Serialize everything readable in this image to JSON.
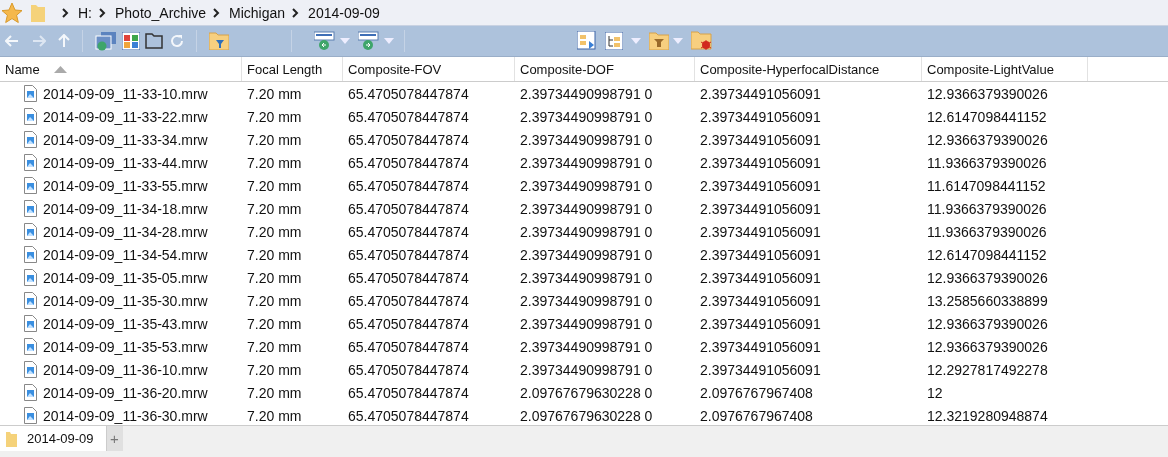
{
  "breadcrumb": {
    "favorite": true,
    "segments": [
      {
        "label": "H:"
      },
      {
        "label": "Photo_Archive"
      },
      {
        "label": "Michigan"
      },
      {
        "label": "2014-09-09"
      }
    ]
  },
  "toolbar": {
    "nav": [
      {
        "kind": "back",
        "disabled": false
      },
      {
        "kind": "forward",
        "disabled": true
      },
      {
        "kind": "up",
        "disabled": false
      }
    ]
  },
  "table": {
    "columns": [
      {
        "label": "Name",
        "sorted": true
      },
      {
        "label": "Focal Length",
        "sorted": false
      },
      {
        "label": "Composite-FOV",
        "sorted": false
      },
      {
        "label": "Composite-DOF",
        "sorted": false
      },
      {
        "label": "Composite-HyperfocalDistance",
        "sorted": false
      },
      {
        "label": "Composite-LightValue",
        "sorted": false
      }
    ],
    "rows": [
      [
        "2014-09-09_11-33-10.mrw",
        "7.20 mm",
        "65.4705078447874",
        "2.39734490998791 0",
        "2.39734491056091",
        "12.9366379390026"
      ],
      [
        "2014-09-09_11-33-22.mrw",
        "7.20 mm",
        "65.4705078447874",
        "2.39734490998791 0",
        "2.39734491056091",
        "12.6147098441152"
      ],
      [
        "2014-09-09_11-33-34.mrw",
        "7.20 mm",
        "65.4705078447874",
        "2.39734490998791 0",
        "2.39734491056091",
        "12.9366379390026"
      ],
      [
        "2014-09-09_11-33-44.mrw",
        "7.20 mm",
        "65.4705078447874",
        "2.39734490998791 0",
        "2.39734491056091",
        "11.9366379390026"
      ],
      [
        "2014-09-09_11-33-55.mrw",
        "7.20 mm",
        "65.4705078447874",
        "2.39734490998791 0",
        "2.39734491056091",
        "11.6147098441152"
      ],
      [
        "2014-09-09_11-34-18.mrw",
        "7.20 mm",
        "65.4705078447874",
        "2.39734490998791 0",
        "2.39734491056091",
        "11.9366379390026"
      ],
      [
        "2014-09-09_11-34-28.mrw",
        "7.20 mm",
        "65.4705078447874",
        "2.39734490998791 0",
        "2.39734491056091",
        "11.9366379390026"
      ],
      [
        "2014-09-09_11-34-54.mrw",
        "7.20 mm",
        "65.4705078447874",
        "2.39734490998791 0",
        "2.39734491056091",
        "12.6147098441152"
      ],
      [
        "2014-09-09_11-35-05.mrw",
        "7.20 mm",
        "65.4705078447874",
        "2.39734490998791 0",
        "2.39734491056091",
        "12.9366379390026"
      ],
      [
        "2014-09-09_11-35-30.mrw",
        "7.20 mm",
        "65.4705078447874",
        "2.39734490998791 0",
        "2.39734491056091",
        "13.2585660338899"
      ],
      [
        "2014-09-09_11-35-43.mrw",
        "7.20 mm",
        "65.4705078447874",
        "2.39734490998791 0",
        "2.39734491056091",
        "12.9366379390026"
      ],
      [
        "2014-09-09_11-35-53.mrw",
        "7.20 mm",
        "65.4705078447874",
        "2.39734490998791 0",
        "2.39734491056091",
        "12.9366379390026"
      ],
      [
        "2014-09-09_11-36-10.mrw",
        "7.20 mm",
        "65.4705078447874",
        "2.39734490998791 0",
        "2.39734491056091",
        "12.2927817492278"
      ],
      [
        "2014-09-09_11-36-20.mrw",
        "7.20 mm",
        "65.4705078447874",
        "2.09767679630228 0",
        "2.0976767967408",
        "12"
      ],
      [
        "2014-09-09_11-36-30.mrw",
        "7.20 mm",
        "65.4705078447874",
        "2.09767679630228 0",
        "2.0976767967408",
        "12.3219280948874"
      ]
    ]
  },
  "tabs": [
    {
      "label": "2014-09-09",
      "selected": true
    }
  ],
  "new_tab": "+"
}
